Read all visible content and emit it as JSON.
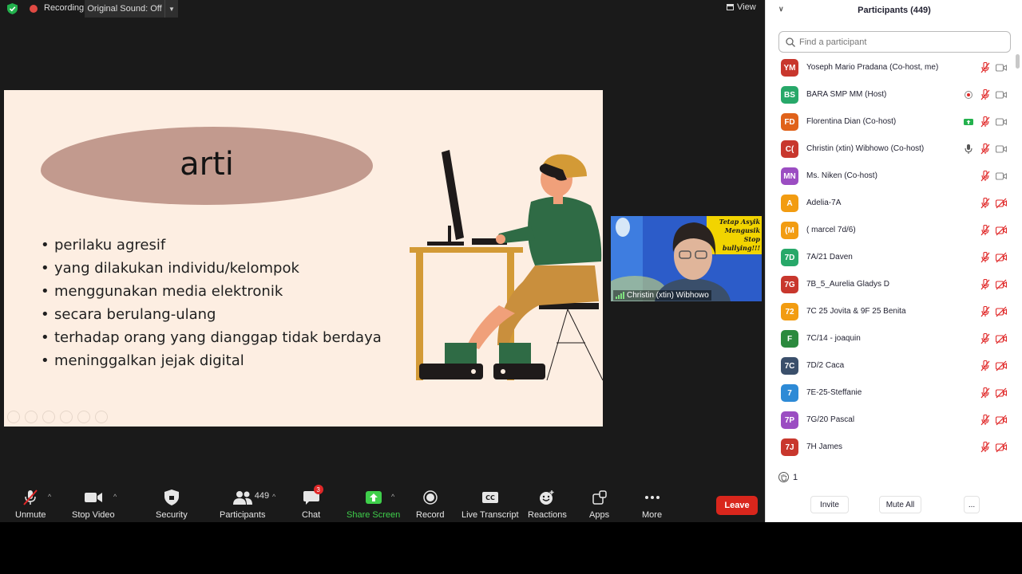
{
  "topbar": {
    "recording_label": "Recording",
    "original_sound_label": "Original Sound: Off",
    "view_label": "View"
  },
  "slide": {
    "title": "arti",
    "bullets": [
      "perilaku agresif",
      "yang dilakukan individu/kelompok",
      "menggunakan media elektronik",
      "secara berulang-ulang",
      "terhadap orang yang dianggap tidak berdaya",
      "meninggalkan jejak digital"
    ]
  },
  "video": {
    "participant_name": "Christin (xtin)  Wibhowo",
    "banner_lines": [
      "Tetap Asyik",
      "Mengusik",
      "Stop",
      "bullying!!!"
    ]
  },
  "toolbar": {
    "unmute": "Unmute",
    "stop_video": "Stop Video",
    "security": "Security",
    "participants": "Participants",
    "participant_count": "449",
    "chat": "Chat",
    "chat_badge": "3",
    "share_screen": "Share Screen",
    "record": "Record",
    "live_transcript": "Live Transcript",
    "reactions": "Reactions",
    "apps": "Apps",
    "more": "More",
    "leave": "Leave"
  },
  "panel": {
    "title": "Participants (449)",
    "search_placeholder": "Find a participant",
    "participants": [
      {
        "initials": "YM",
        "name": "Yoseph Mario Pradana (Co-host, me)",
        "color": "#c8372d",
        "extra": "",
        "video_off": false
      },
      {
        "initials": "BS",
        "name": "BARA SMP MM (Host)",
        "color": "#27a869",
        "extra": "record",
        "video_off": false
      },
      {
        "initials": "FD",
        "name": "Florentina Dian (Co-host)",
        "color": "#e0621a",
        "extra": "share",
        "video_off": false
      },
      {
        "initials": "C(",
        "name": "Christin (xtin)  Wibhowo (Co-host)",
        "color": "#c8372d",
        "extra": "mic",
        "video_off": false
      },
      {
        "initials": "MN",
        "name": "Ms. Niken (Co-host)",
        "color": "#9b4dc2",
        "extra": "",
        "video_off": false
      },
      {
        "initials": "A",
        "name": " Adelia-7A",
        "color": "#f29c11",
        "extra": "",
        "video_off": true
      },
      {
        "initials": "(M",
        "name": "( marcel 7d/6)",
        "color": "#f29c11",
        "extra": "",
        "video_off": true
      },
      {
        "initials": "7D",
        "name": "7A/21 Daven",
        "color": "#27a869",
        "extra": "",
        "video_off": true
      },
      {
        "initials": "7G",
        "name": "7B_5_Aurelia Gladys D",
        "color": "#c8372d",
        "extra": "",
        "video_off": true
      },
      {
        "initials": "72",
        "name": "7C 25 Jovita & 9F 25 Benita",
        "color": "#f29c11",
        "extra": "",
        "video_off": true
      },
      {
        "initials": "F",
        "name": "7C/14 - joaquin",
        "color": "#2b8a3e",
        "extra": "",
        "video_off": true
      },
      {
        "initials": "7C",
        "name": "7D/2 Caca",
        "color": "#3a4f6b",
        "extra": "",
        "video_off": true
      },
      {
        "initials": "7",
        "name": "7E-25-Steffanie",
        "color": "#2d8ad6",
        "extra": "",
        "video_off": true
      },
      {
        "initials": "7P",
        "name": "7G/20 Pascal",
        "color": "#9b4dc2",
        "extra": "",
        "video_off": true
      },
      {
        "initials": "7J",
        "name": "7H James",
        "color": "#c8372d",
        "extra": "",
        "video_off": true
      }
    ],
    "raised_hands_count": "1",
    "invite_label": "Invite",
    "mute_all_label": "Mute All",
    "more_label": "..."
  }
}
